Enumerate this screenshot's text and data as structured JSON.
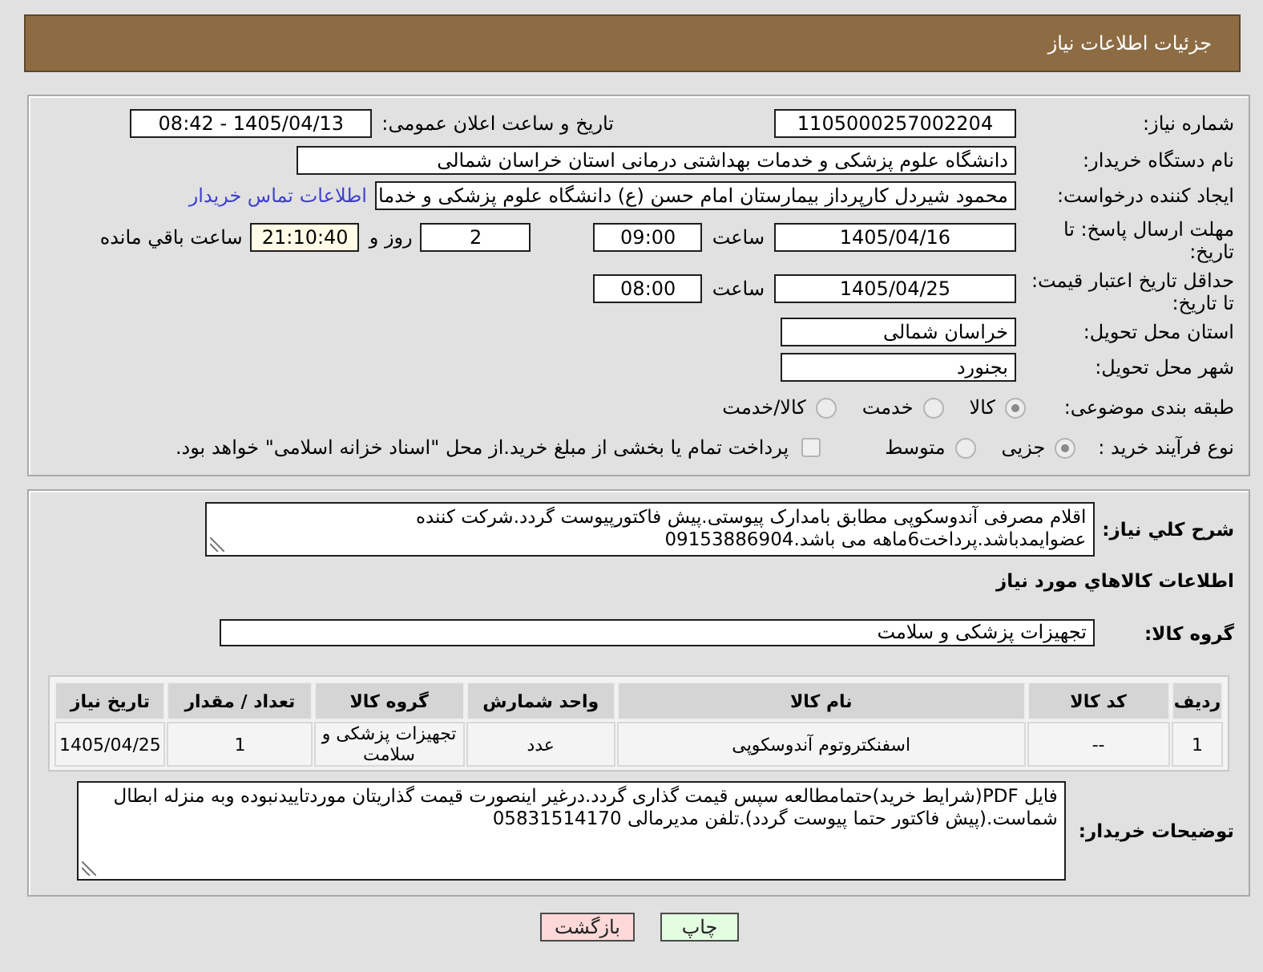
{
  "header": {
    "title": "جزئیات اطلاعات نیاز"
  },
  "summary": {
    "need_number": {
      "label": "شماره نیاز:",
      "value": "1105000257002204"
    },
    "announce_datetime": {
      "label": "تاریخ و ساعت اعلان عمومی:",
      "value": "1405/04/13 - 08:42"
    },
    "buyer_org": {
      "label": "نام دستگاه خریدار:",
      "value": "دانشگاه علوم پزشکی و خدمات بهداشتی درمانی استان خراسان شمالی"
    },
    "requester": {
      "label": "ایجاد کننده درخواست:",
      "value": "محمود شیردل کارپرداز بیمارستان امام حسن (ع) دانشگاه علوم پزشکی و خدما",
      "link": "اطلاعات تماس خریدار"
    },
    "response_deadline": {
      "label": "مهلت ارسال پاسخ: تا تاریخ:",
      "date": "1405/04/16",
      "time_label": "ساعت",
      "time": "09:00",
      "days": "2",
      "days_label": "روز و",
      "remaining": "21:10:40",
      "remaining_label": "ساعت باقي مانده"
    },
    "price_validity": {
      "label": "حداقل تاریخ اعتبار قیمت: تا تاریخ:",
      "date": "1405/04/25",
      "time_label": "ساعت",
      "time": "08:00"
    },
    "delivery_province": {
      "label": "استان محل تحویل:",
      "value": "خراسان شمالی"
    },
    "delivery_city": {
      "label": "شهر محل تحویل:",
      "value": "بجنورد"
    },
    "category": {
      "label": "طبقه بندی موضوعی:",
      "options": [
        {
          "label": "کالا",
          "selected": true
        },
        {
          "label": "خدمت",
          "selected": false
        },
        {
          "label": "کالا/خدمت",
          "selected": false
        }
      ]
    },
    "process_type": {
      "label": "نوع فرآیند خرید :",
      "options": [
        {
          "label": "جزیی",
          "selected": true
        },
        {
          "label": "متوسط",
          "selected": false
        }
      ],
      "treasury": {
        "label": "پرداخت تمام یا بخشی از مبلغ خرید.از محل \"اسناد خزانه اسلامی\" خواهد بود.",
        "checked": false
      }
    }
  },
  "details": {
    "description": {
      "label": "شرح کلي نیاز:",
      "value": "اقلام مصرفی آندوسکوپی مطابق بامدارک پیوستی.پیش فاکتورپیوست گردد.شرکت کننده عضوایمدباشد.پرداخت6ماهه می باشد.09153886904"
    },
    "goods_title": "اطلاعات کالاهاي مورد نیاز",
    "goods_group": {
      "label": "گروه کالا:",
      "value": "تجهیزات پزشکی و سلامت"
    },
    "table": {
      "columns": [
        "ردیف",
        "کد کالا",
        "نام کالا",
        "واحد شمارش",
        "گروه کالا",
        "تعداد / مقدار",
        "تاریخ نیاز"
      ],
      "rows": [
        [
          "1",
          "--",
          "اسفنکتروتوم آندوسکوپی",
          "عدد",
          "تجهیزات پزشکی و سلامت",
          "1",
          "1405/04/25"
        ]
      ]
    },
    "buyer_notes": {
      "label": "توضیحات خریدار:",
      "value": "فایل PDF(شرایط خرید)حتمامطالعه سپس قیمت گذاری گردد.درغیر اینصورت قیمت گذاریتان موردتاییدنبوده وبه منزله ابطال شماست.(پیش فاکتور حتما پیوست گردد).تلفن مدیرمالی 05831514170"
    }
  },
  "buttons": [
    {
      "label": "چاپ",
      "kind": "print"
    },
    {
      "label": "بازگشت",
      "kind": "back"
    }
  ]
}
